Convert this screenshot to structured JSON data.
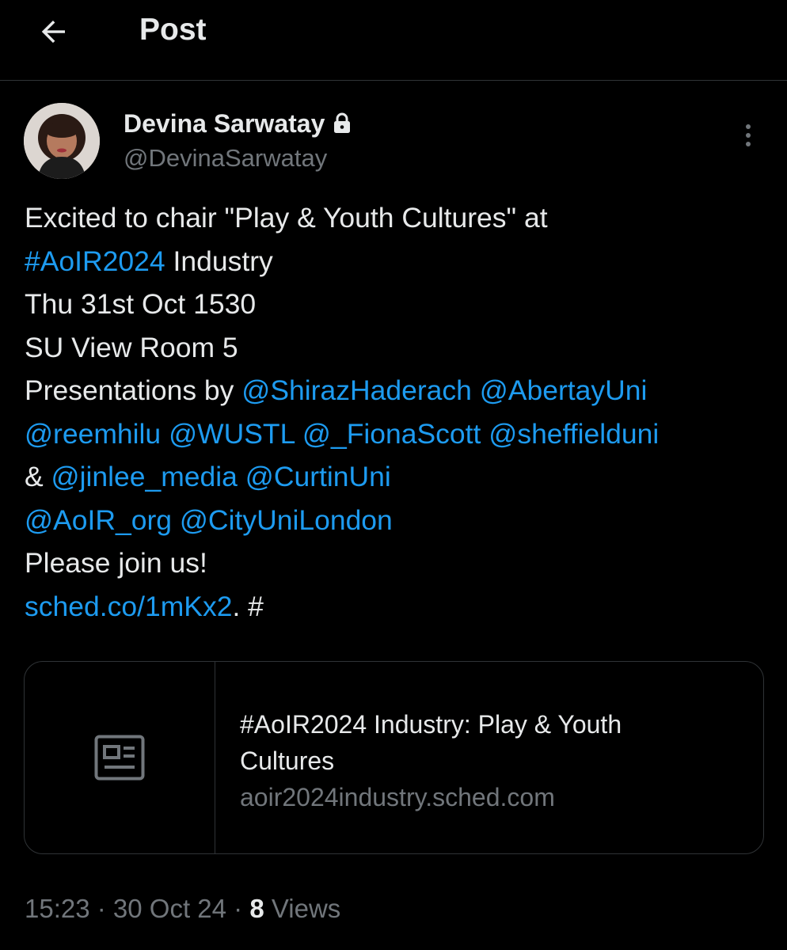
{
  "header": {
    "title": "Post",
    "back_icon": "arrow-left-icon"
  },
  "author": {
    "display_name": "Devina Sarwatay",
    "handle": "@DevinaSarwatay",
    "protected_icon": "lock-icon"
  },
  "more_icon": "more-vertical-icon",
  "tweet": {
    "lines": [
      [
        {
          "text": "Excited to chair \"Play & Youth Cultures\" at",
          "link": false
        }
      ],
      [
        {
          "text": "#AoIR2024",
          "link": true
        },
        {
          "text": " Industry",
          "link": false
        }
      ],
      [
        {
          "text": "Thu 31st Oct 1530",
          "link": false
        }
      ],
      [
        {
          "text": "SU View Room 5",
          "link": false
        }
      ],
      [
        {
          "text": "Presentations by ",
          "link": false
        },
        {
          "text": "@ShirazHaderach",
          "link": true
        },
        {
          "text": " ",
          "link": false
        },
        {
          "text": "@AbertayUni",
          "link": true
        }
      ],
      [
        {
          "text": "@reemhilu",
          "link": true
        },
        {
          "text": " ",
          "link": false
        },
        {
          "text": "@WUSTL",
          "link": true
        },
        {
          "text": " ",
          "link": false
        },
        {
          "text": "@_FionaScott",
          "link": true
        },
        {
          "text": " ",
          "link": false
        },
        {
          "text": "@sheffielduni",
          "link": true
        }
      ],
      [
        {
          "text": "& ",
          "link": false
        },
        {
          "text": "@jinlee_media",
          "link": true
        },
        {
          "text": " ",
          "link": false
        },
        {
          "text": "@CurtinUni",
          "link": true
        }
      ],
      [
        {
          "text": "@AoIR_org",
          "link": true
        },
        {
          "text": " ",
          "link": false
        },
        {
          "text": "@CityUniLondon",
          "link": true
        }
      ],
      [
        {
          "text": "Please join us!",
          "link": false
        }
      ],
      [
        {
          "text": " ",
          "link": false
        },
        {
          "text": "sched.co/1mKx2",
          "link": true
        },
        {
          "text": ". #",
          "link": false
        }
      ]
    ]
  },
  "card": {
    "icon": "news-article-icon",
    "title": "#AoIR2024 Industry: Play & Youth Cultures",
    "domain": "aoir2024industry.sched.com"
  },
  "meta": {
    "time": "15:23",
    "sep1": " · ",
    "date": "30 Oct 24",
    "sep2": " · ",
    "views_count": "8",
    "views_label": " Views"
  },
  "colors": {
    "background": "#000000",
    "text": "#e7e9ea",
    "secondary": "#71767b",
    "link": "#1d9bf0",
    "border": "#2f3336"
  }
}
